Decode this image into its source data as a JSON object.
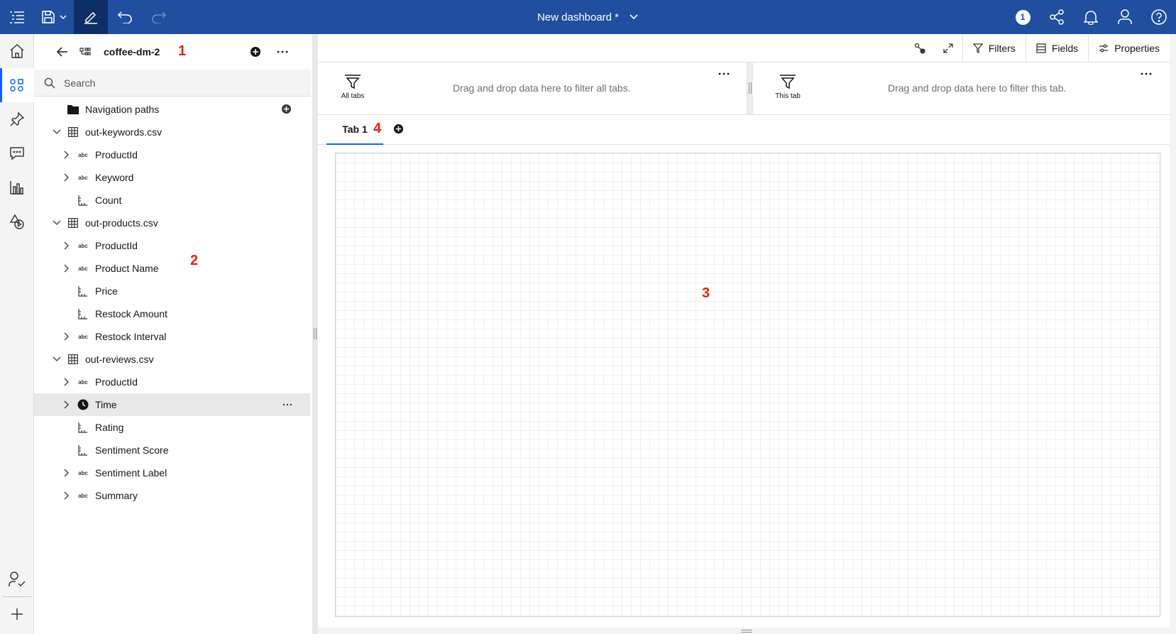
{
  "header": {
    "title": "New dashboard *",
    "notification_count": "1"
  },
  "panel": {
    "module_name": "coffee-dm-2",
    "search_placeholder": "Search",
    "tree": [
      {
        "label": "Navigation paths",
        "level": 0,
        "kind": "folder",
        "expanded": null
      },
      {
        "label": "out-keywords.csv",
        "level": 0,
        "kind": "table",
        "expanded": true
      },
      {
        "label": "ProductId",
        "level": 1,
        "kind": "abc",
        "expanded": false
      },
      {
        "label": "Keyword",
        "level": 1,
        "kind": "abc",
        "expanded": false
      },
      {
        "label": "Count",
        "level": 1,
        "kind": "measure",
        "expanded": null
      },
      {
        "label": "out-products.csv",
        "level": 0,
        "kind": "table",
        "expanded": true
      },
      {
        "label": "ProductId",
        "level": 1,
        "kind": "abc",
        "expanded": false
      },
      {
        "label": "Product Name",
        "level": 1,
        "kind": "abc",
        "expanded": false
      },
      {
        "label": "Price",
        "level": 1,
        "kind": "measure",
        "expanded": null
      },
      {
        "label": "Restock Amount",
        "level": 1,
        "kind": "measure",
        "expanded": null
      },
      {
        "label": "Restock Interval",
        "level": 1,
        "kind": "abc",
        "expanded": false
      },
      {
        "label": "out-reviews.csv",
        "level": 0,
        "kind": "table",
        "expanded": true
      },
      {
        "label": "ProductId",
        "level": 1,
        "kind": "abc",
        "expanded": false
      },
      {
        "label": "Time",
        "level": 1,
        "kind": "time",
        "expanded": false,
        "selected": true
      },
      {
        "label": "Rating",
        "level": 1,
        "kind": "measure",
        "expanded": null
      },
      {
        "label": "Sentiment Score",
        "level": 1,
        "kind": "measure",
        "expanded": null
      },
      {
        "label": "Sentiment Label",
        "level": 1,
        "kind": "abc",
        "expanded": false
      },
      {
        "label": "Summary",
        "level": 1,
        "kind": "abc",
        "expanded": false
      }
    ]
  },
  "toolbar": {
    "filters_label": "Filters",
    "fields_label": "Fields",
    "properties_label": "Properties"
  },
  "filter_zones": {
    "all_tabs_label": "All tabs",
    "all_tabs_hint": "Drag and drop data here to filter all tabs.",
    "this_tab_label": "This tab",
    "this_tab_hint": "Drag and drop data here to filter this tab."
  },
  "tabs": [
    {
      "label": "Tab 1",
      "active": true
    }
  ],
  "markers": [
    "1",
    "2",
    "3",
    "4"
  ],
  "icons": {
    "abc_type": "abc"
  },
  "colors": {
    "header_bg": "#1f4f9e",
    "accent": "#0f62fe",
    "marker": "#e8230b"
  }
}
